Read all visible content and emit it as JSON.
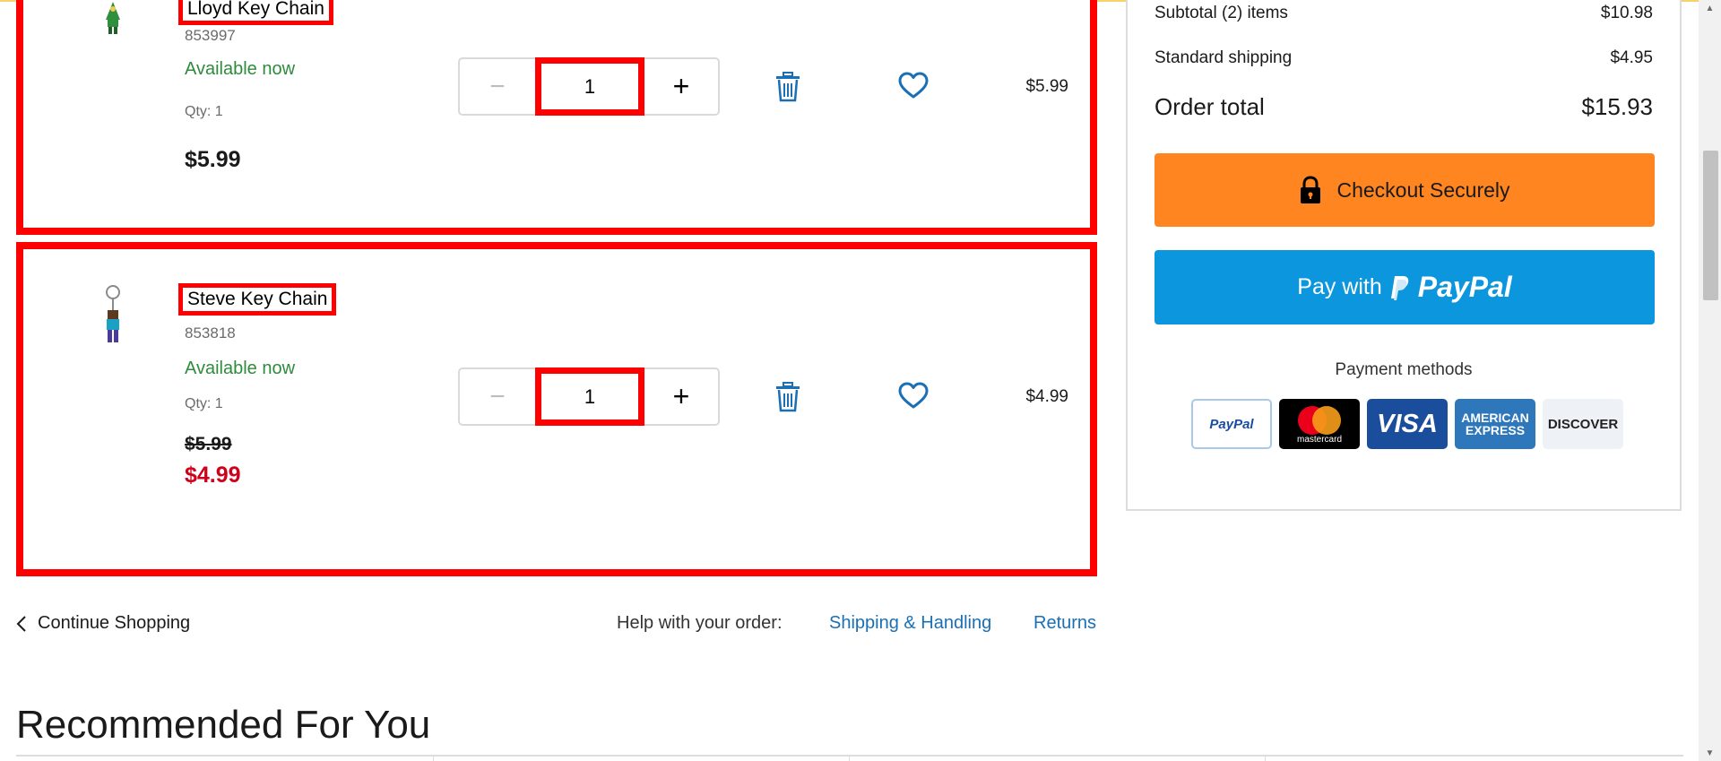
{
  "cart_items": [
    {
      "name": "Lloyd Key Chain",
      "sku": "853997",
      "availability": "Available now",
      "qty_label": "Qty: 1",
      "quantity": "1",
      "price": "$5.99",
      "line_price": "$5.99"
    },
    {
      "name": "Steve Key Chain",
      "sku": "853818",
      "availability": "Available now",
      "qty_label": "Qty: 1",
      "quantity": "1",
      "original_price": "$5.99",
      "sale_price": "$4.99",
      "line_price": "$4.99"
    }
  ],
  "stepper": {
    "minus": "−",
    "plus": "+"
  },
  "summary": {
    "subtotal_label": "Subtotal (2) items",
    "subtotal_value": "$10.98",
    "shipping_label": "Standard shipping",
    "shipping_value": "$4.95",
    "total_label": "Order total",
    "total_value": "$15.93",
    "checkout_label": "Checkout Securely",
    "paypal_pay": "Pay with",
    "paypal_brand": "PayPal",
    "payment_methods_title": "Payment methods",
    "cards": {
      "paypal": "PayPal",
      "mastercard": "mastercard",
      "visa": "VISA",
      "amex_line1": "AMERICAN",
      "amex_line2": "EXPRESS",
      "discover": "DISCOVER"
    }
  },
  "footer": {
    "continue_shopping": "Continue Shopping",
    "help_label": "Help with your order:",
    "shipping_link": "Shipping & Handling",
    "returns_link": "Returns"
  },
  "recommended_title": "Recommended For You",
  "colors": {
    "highlight": "#ff0000",
    "available": "#2e8b3c",
    "sale": "#d0021b",
    "link": "#1a6fb5",
    "checkout": "#ff8521",
    "paypal": "#0b96dd"
  },
  "icons": {
    "trash": "trash-icon",
    "heart": "heart-icon",
    "lock": "lock-icon",
    "chevron": "chevron-left-icon"
  }
}
